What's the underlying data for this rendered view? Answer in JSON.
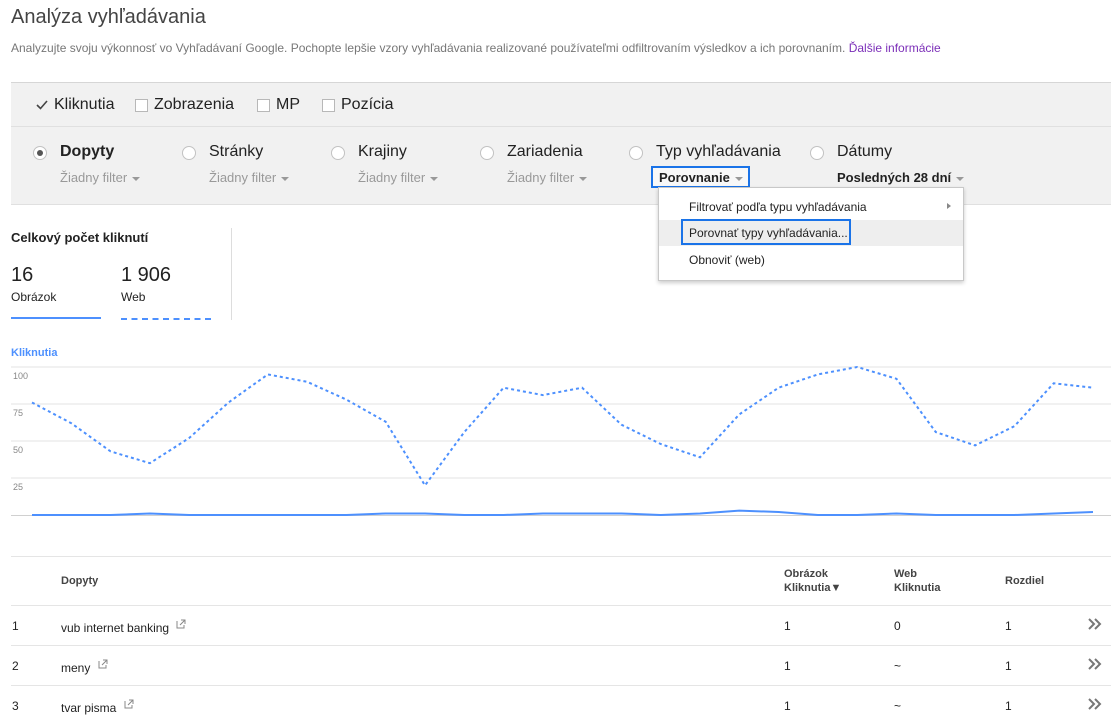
{
  "header": {
    "title": "Analýza vyhľadávania",
    "description": "Analyzujte svoju výkonnosť vo Vyhľadávaní Google. Pochopte lepšie vzory vyhľadávania realizované používateľmi odfiltrovaním výsledkov a ich porovnaním.",
    "more_link": "Ďalšie informácie"
  },
  "metrics": [
    {
      "label": "Kliknutia",
      "checked": true
    },
    {
      "label": "Zobrazenia",
      "checked": false
    },
    {
      "label": "MP",
      "checked": false
    },
    {
      "label": "Pozícia",
      "checked": false
    }
  ],
  "dimensions": [
    {
      "label": "Dopyty",
      "filter": "Žiadny filter",
      "selected": true
    },
    {
      "label": "Stránky",
      "filter": "Žiadny filter",
      "selected": false
    },
    {
      "label": "Krajiny",
      "filter": "Žiadny filter",
      "selected": false
    },
    {
      "label": "Zariadenia",
      "filter": "Žiadny filter",
      "selected": false
    },
    {
      "label": "Typ vyhľadávania",
      "filter": "Porovnanie",
      "selected": false
    },
    {
      "label": "Dátumy",
      "filter": "Posledných 28 dní",
      "selected": false
    }
  ],
  "dropdown": {
    "items": [
      "Filtrovať podľa typu vyhľadávania",
      "Porovnať typy vyhľadávania...",
      "Obnoviť (web)"
    ]
  },
  "totals": {
    "title": "Celkový počet kliknutí",
    "items": [
      {
        "value": "16",
        "label": "Obrázok"
      },
      {
        "value": "1 906",
        "label": "Web"
      }
    ]
  },
  "chart_label": "Kliknutia",
  "chart_data": {
    "type": "line",
    "title": "",
    "ylabel": "Kliknutia",
    "ylim": [
      0,
      100
    ],
    "yticks": [
      25,
      50,
      75,
      100
    ],
    "grid": true,
    "series": [
      {
        "name": "Web",
        "style": "dashed",
        "color": "#4d90fe",
        "values": [
          76,
          62,
          43,
          35,
          52,
          76,
          95,
          90,
          78,
          63,
          20,
          56,
          86,
          81,
          86,
          61,
          48,
          39,
          68,
          86,
          95,
          100,
          92,
          56,
          47,
          60,
          89,
          86
        ]
      },
      {
        "name": "Obrázok",
        "style": "solid",
        "color": "#4d90fe",
        "values": [
          0,
          0,
          0,
          1,
          0,
          0,
          0,
          0,
          0,
          1,
          1,
          0,
          0,
          1,
          1,
          1,
          0,
          1,
          3,
          2,
          0,
          0,
          1,
          0,
          0,
          0,
          1,
          2
        ]
      }
    ]
  },
  "table": {
    "headers": {
      "query": "Dopyty",
      "image_top": "Obrázok",
      "image_bottom": "Kliknutia▼",
      "web_top": "Web",
      "web_bottom": "Kliknutia",
      "diff": "Rozdiel"
    },
    "rows": [
      {
        "num": "1",
        "query": "vub internet banking",
        "image": "1",
        "web": "0",
        "diff": "1"
      },
      {
        "num": "2",
        "query": "meny",
        "image": "1",
        "web": "~",
        "diff": "1"
      },
      {
        "num": "3",
        "query": "tvar pisma",
        "image": "1",
        "web": "~",
        "diff": "1"
      }
    ]
  }
}
